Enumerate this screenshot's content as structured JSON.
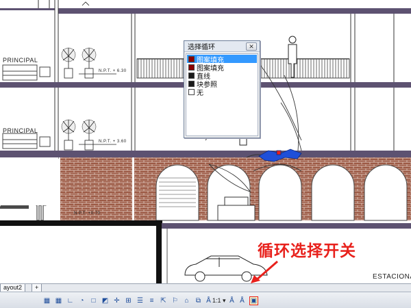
{
  "drawing": {
    "level_label_1": "PRINCIPAL",
    "level_label_2": "PRINCIPAL",
    "elev_1": "N.P.T. + 6.30",
    "elev_2": "N.P.T. + 3.60",
    "elev_3": "N.P.T. +0.70",
    "garage_label": "ESTACIONAM"
  },
  "dialog": {
    "title": "选择循环",
    "close_glyph": "✕",
    "items": [
      {
        "label": "图案填充",
        "swatch": "#8b0000",
        "selected": true
      },
      {
        "label": "图案填充",
        "swatch": "#8b0000",
        "selected": false
      },
      {
        "label": "直线",
        "swatch": "#1a1a1a",
        "selected": false
      },
      {
        "label": "块参照",
        "swatch": "#1a1a1a",
        "selected": false
      },
      {
        "label": "无",
        "swatch": "#ffffff",
        "selected": false
      }
    ]
  },
  "annotation": {
    "text": "循环选择开关",
    "color": "#e8211c"
  },
  "tabs": {
    "layout2": "ayout2",
    "add": "+"
  },
  "statusbar": {
    "scale": "1:1",
    "scale_arrow": "▾"
  },
  "colors": {
    "brick": "#9c5a45",
    "floor_slab": "#5d5271",
    "highlight": "#e8211c",
    "selection_blue": "#3399ff"
  }
}
